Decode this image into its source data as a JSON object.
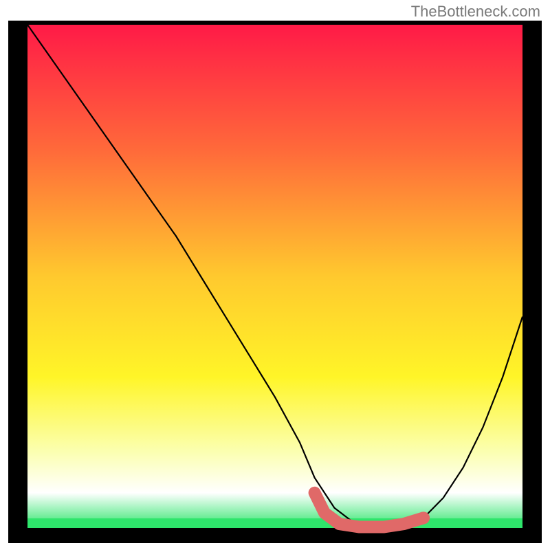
{
  "attribution": "TheBottleneck.com",
  "chart_data": {
    "type": "line",
    "title": "",
    "xlabel": "",
    "ylabel": "",
    "xlim": [
      0,
      100
    ],
    "ylim": [
      0,
      100
    ],
    "background_gradient": {
      "stops": [
        {
          "offset": 0.0,
          "color": "#ff1a47"
        },
        {
          "offset": 0.25,
          "color": "#ff6a3a"
        },
        {
          "offset": 0.5,
          "color": "#ffc92e"
        },
        {
          "offset": 0.7,
          "color": "#fff528"
        },
        {
          "offset": 0.85,
          "color": "#fbffb2"
        },
        {
          "offset": 0.93,
          "color": "#ffffff"
        },
        {
          "offset": 1.0,
          "color": "#2ee56b"
        }
      ]
    },
    "bottom_band_color": "#2ee56b",
    "curve": {
      "description": "bottleneck curve (black), V-shaped minimum region",
      "x": [
        0,
        5,
        10,
        15,
        20,
        25,
        30,
        35,
        40,
        45,
        50,
        55,
        58,
        62,
        66,
        70,
        74,
        78,
        80,
        84,
        88,
        92,
        96,
        100
      ],
      "y": [
        100,
        93,
        86,
        79,
        72,
        65,
        58,
        50,
        42,
        34,
        26,
        17,
        10,
        4,
        1,
        0,
        0,
        1,
        2,
        6,
        12,
        20,
        30,
        42
      ]
    },
    "highlight_segment": {
      "description": "salmon/red thick segment at curve minimum",
      "color": "#e06968",
      "x": [
        58,
        60,
        63,
        67,
        72,
        76,
        80
      ],
      "y": [
        7,
        3,
        0.8,
        0.2,
        0.2,
        0.8,
        2
      ]
    },
    "highlight_point": {
      "color": "#e06968",
      "x": 80,
      "y": 2
    }
  }
}
